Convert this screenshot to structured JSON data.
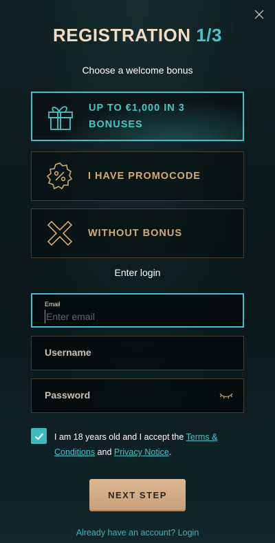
{
  "header": {
    "title_main": "REGISTRATION",
    "title_step": "1/3",
    "close_icon": "close-icon"
  },
  "bonus_section": {
    "label": "Choose a welcome bonus",
    "options": [
      {
        "label_line1": "UP TO €1,000 IN 3",
        "label_line2": "BONUSES",
        "icon": "gift-icon",
        "selected": true
      },
      {
        "label_line1": "I HAVE PROMOCODE",
        "label_line2": "",
        "icon": "promocode-badge-icon",
        "selected": false
      },
      {
        "label_line1": "WITHOUT BONUS",
        "label_line2": "",
        "icon": "cross-icon",
        "selected": false
      }
    ]
  },
  "login_section": {
    "label": "Enter login",
    "email": {
      "label": "Email",
      "placeholder": "Enter email",
      "value": ""
    },
    "username": {
      "label": "Username"
    },
    "password": {
      "label": "Password",
      "toggle_icon": "eye-closed-icon"
    }
  },
  "consent": {
    "checked": true,
    "text_before": "I am 18 years old and I accept the ",
    "terms_link": "Terms & Conditions",
    "text_middle": " and ",
    "privacy_link": "Privacy Notice",
    "text_after": "."
  },
  "actions": {
    "next_label": "NEXT STEP",
    "login_link": "Already have an account? Login"
  },
  "colors": {
    "accent_teal": "#43bfc5",
    "accent_gold": "#d6aa73",
    "background": "#0c1a1c"
  }
}
